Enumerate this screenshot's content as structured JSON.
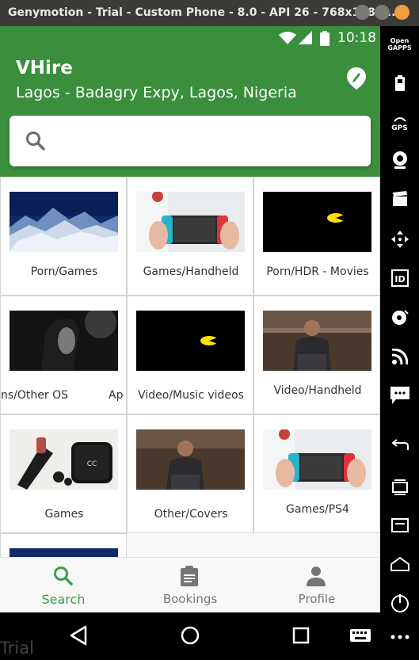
{
  "window": {
    "title": "Genymotion - Trial - Custom Phone - 8.0 - API 26 - 768x1280..."
  },
  "status_bar": {
    "time": "10:18"
  },
  "app": {
    "title": "VHire",
    "location": "Lagos - Badagry Expy, Lagos, Nigeria",
    "search": {
      "value": "",
      "placeholder": ""
    }
  },
  "grid": {
    "items": [
      {
        "label": "Porn/Games",
        "image": "snowy-mountains"
      },
      {
        "label": "Games/Handheld",
        "image": "handheld-console"
      },
      {
        "label": "Porn/HDR - Movies",
        "image": "yellow-blob-dark"
      },
      {
        "label": "ns/Other OS",
        "label_extra": "Ap",
        "image": "woman-portrait-dark"
      },
      {
        "label": "Video/Music videos",
        "image": "yellow-blob-dark"
      },
      {
        "label": "Video/Handheld",
        "image": "man-sitting-cafe"
      },
      {
        "label": "Games",
        "image": "chanel-compact"
      },
      {
        "label": "Other/Covers",
        "image": "man-sitting-cafe"
      },
      {
        "label": "Games/PS4",
        "image": "handheld-console"
      },
      {
        "label": "",
        "image": "blue-partial"
      }
    ]
  },
  "bottom_nav": {
    "items": [
      {
        "label": "Search",
        "icon": "search-icon",
        "active": true
      },
      {
        "label": "Bookings",
        "icon": "clipboard-icon",
        "active": false
      },
      {
        "label": "Profile",
        "icon": "person-icon",
        "active": false
      }
    ]
  },
  "watermark": "Trial",
  "sidebar": {
    "open_gapps_label": "Open GAPPS",
    "gps_label": "GPS",
    "id_label": "ID"
  },
  "colors": {
    "brand_green": "#3a8e3c",
    "active_nav": "#3a9e4a",
    "inactive_nav": "#757575"
  }
}
